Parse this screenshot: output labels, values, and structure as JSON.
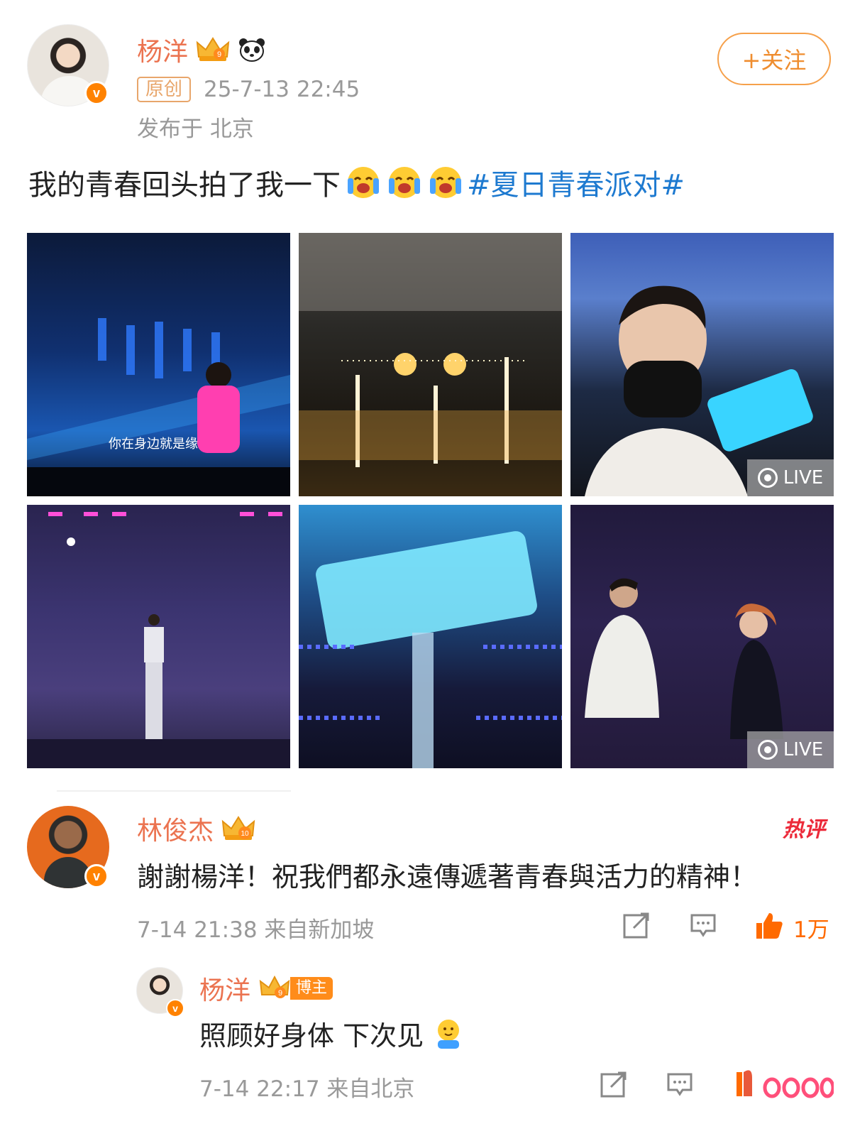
{
  "post": {
    "author": "杨洋",
    "tag": "原创",
    "timestamp": "25-7-13 22:45",
    "location": "发布于 北京",
    "follow_label": "+关注",
    "text": "我的青春回头拍了我一下",
    "topic": "#夏日青春派对#",
    "level_badge": "9",
    "emoji_count": 3,
    "images": [
      {
        "caption": "你在身边就是缘",
        "live": false
      },
      {
        "caption": "",
        "live": false
      },
      {
        "caption": "",
        "live": true
      },
      {
        "caption": "",
        "live": false
      },
      {
        "caption": "",
        "live": false
      },
      {
        "caption": "",
        "live": true
      }
    ],
    "live_label": "LIVE"
  },
  "comments": [
    {
      "author": "林俊杰",
      "level_badge": "10",
      "hot_label": "热评",
      "text": "謝謝楊洋！祝我們都永遠傳遞著青春與活力的精神！",
      "meta": "7-14 21:38 来自新加坡",
      "likes": "1万"
    }
  ],
  "reply": {
    "author": "杨洋",
    "level_badge": "9",
    "blogger_tag": "博主",
    "text": "照顾好身体 下次见",
    "meta": "7-14 22:17 来自北京"
  },
  "colors": {
    "accent": "#eb7350",
    "topic": "#1e7ad0",
    "like": "#ff6a00",
    "verified": "#ff8200"
  }
}
